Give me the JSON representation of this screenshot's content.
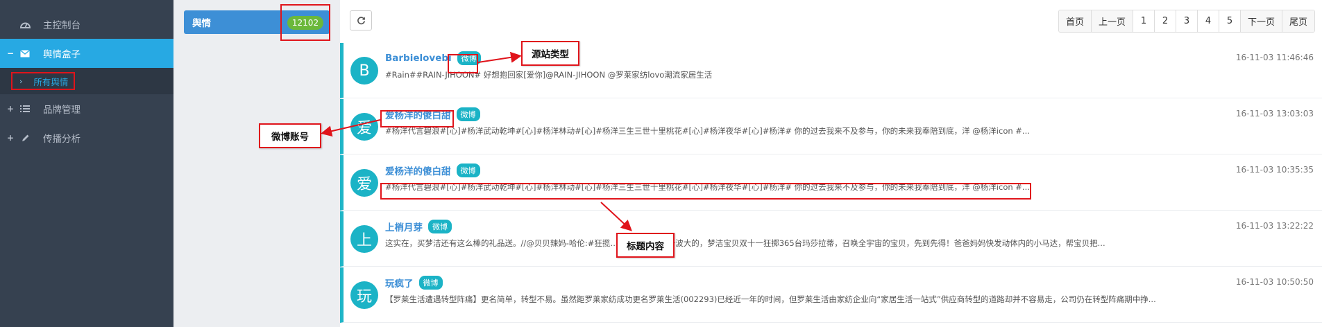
{
  "sidebar": {
    "items": [
      {
        "label": "主控制台",
        "icon": "dashboard-icon",
        "toggle": ""
      },
      {
        "label": "舆情盒子",
        "icon": "envelope-icon",
        "toggle": "−"
      },
      {
        "label": "品牌管理",
        "icon": "list-icon",
        "toggle": "+"
      },
      {
        "label": "传播分析",
        "icon": "pencil-icon",
        "toggle": "+"
      }
    ],
    "sub_items": [
      {
        "label": "所有舆情",
        "arrow": "›"
      }
    ]
  },
  "filter": {
    "topic_label": "舆情",
    "topic_count": "12102"
  },
  "toolbar": {
    "refresh_icon": "refresh-icon"
  },
  "pagination": {
    "first": "首页",
    "prev": "上一页",
    "pages": [
      "1",
      "2",
      "3",
      "4",
      "5"
    ],
    "next": "下一页",
    "last": "尾页"
  },
  "posts": [
    {
      "avatar": "B",
      "author": "Barbielovebi",
      "source": "微博",
      "time": "16-11-03 11:46:46",
      "text": "#Rain##RAIN-JIHOON# 好想抱回家[爱你]@RAIN-JIHOON @罗莱家纺lovo潮流家居生活"
    },
    {
      "avatar": "爱",
      "author": "爱杨洋的傻白甜",
      "source": "微博",
      "time": "16-11-03 13:03:03",
      "text": "#杨洋代言碧浪#[心]#杨洋武动乾坤#[心]#杨洋林动#[心]#杨洋三生三世十里桃花#[心]#杨洋夜华#[心]#杨洋# 你的过去我来不及参与，你的未来我奉陪到底，洋 @杨洋icon #..."
    },
    {
      "avatar": "爱",
      "author": "爱杨洋的傻白甜",
      "source": "微博",
      "time": "16-11-03 10:35:35",
      "text": "#杨洋代言碧浪#[心]#杨洋武动乾坤#[心]#杨洋林动#[心]#杨洋三生三世十里桃花#[心]#杨洋夜华#[心]#杨洋# 你的过去我来不及参与，你的未来我奉陪到底，洋 @杨洋icon #..."
    },
    {
      "avatar": "上",
      "author": "上梢月芽",
      "source": "微博",
      "time": "16-11-03 13:22:22",
      "text": "这实在，买梦洁还有这么棒的礼品送。//@贝贝辣妈-哈伦:#狂揽…                      #这一次要玩一波大的，梦洁宝贝双十一狂掷365台玛莎拉蒂，召唤全宇宙的宝贝，先到先得！爸爸妈妈快发动体内的小马达，帮宝贝把..."
    },
    {
      "avatar": "玩",
      "author": "玩疯了",
      "source": "微博",
      "time": "16-11-03 10:50:50",
      "text": "【罗莱生活遭遇转型阵痛】更名简单，转型不易。虽然距罗莱家纺成功更名罗莱生活(002293)已经近一年的时间，但罗莱生活由家纺企业向“家居生活一站式”供应商转型的道路却并不容易走，公司仍在转型阵痛期中挣..."
    }
  ],
  "annotations": {
    "source_type": "源站类型",
    "weibo_account": "微博账号",
    "title_content": "标题内容"
  },
  "colors": {
    "sidebar_bg": "#364150",
    "active_nav": "#27a9e3",
    "topic_button": "#3d8fd6",
    "count_badge": "#6bb83a",
    "source_badge": "#1bb3c6",
    "annotation_red": "#e0141b"
  }
}
